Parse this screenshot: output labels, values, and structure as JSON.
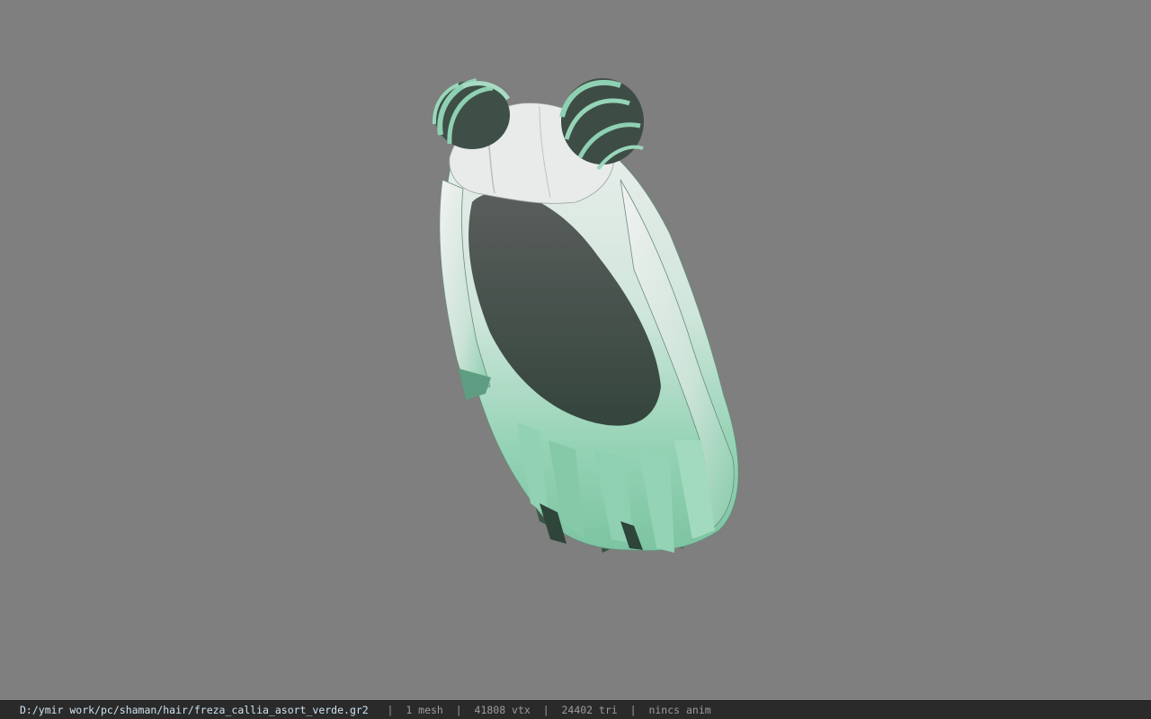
{
  "viewer": {
    "background_color": "#7f7f7f",
    "model": "hair-mesh",
    "model_colors": {
      "white": "#e6e9e8",
      "mint": "#8fd0b2",
      "dark": "#3f5a4e"
    }
  },
  "statusbar": {
    "file_path": "D:/ymir work/pc/shaman/hair/freza_callia_asort_verde.gr2",
    "separator": "|",
    "mesh_count": "1 mesh",
    "vertex_count": "41808 vtx",
    "triangle_count": "24402 tri",
    "animation": "nincs anim"
  }
}
